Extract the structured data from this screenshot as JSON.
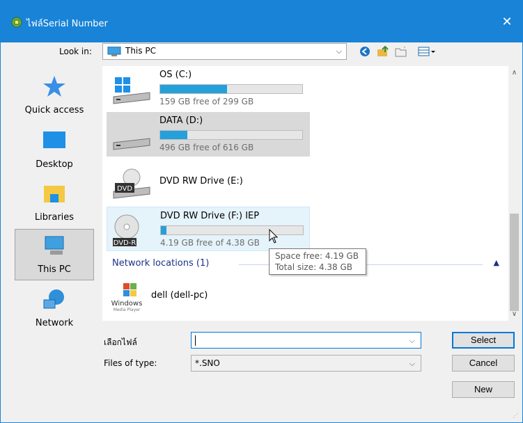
{
  "window": {
    "title": "ไฟล์Serial Number",
    "close_label": "✕"
  },
  "lookin": {
    "label": "Look in:",
    "value": "This PC"
  },
  "places": [
    {
      "label": "Quick access"
    },
    {
      "label": "Desktop"
    },
    {
      "label": "Libraries"
    },
    {
      "label": "This PC"
    },
    {
      "label": "Network"
    }
  ],
  "drives": [
    {
      "name": "OS (C:)",
      "free": "159 GB free of 299 GB",
      "used_fraction": 0.47
    },
    {
      "name": "DATA (D:)",
      "free": "496 GB free of 616 GB",
      "used_fraction": 0.19
    },
    {
      "name": "DVD RW Drive (E:)",
      "badge": "DVD"
    },
    {
      "name": "DVD RW Drive (F:) IEP",
      "free": "4.19 GB free of 4.38 GB",
      "used_fraction": 0.04,
      "badge": "DVD-R"
    }
  ],
  "network_group": {
    "label": "Network locations (1)"
  },
  "network_item": {
    "name": "dell (dell-pc)",
    "icon_text_1": "Windows",
    "icon_text_2": "Media Player"
  },
  "tooltip": {
    "line1": "Space free: 4.19 GB",
    "line2": "Total size: 4.38 GB"
  },
  "file_name": {
    "label": "เลือกไฟล์",
    "value": ""
  },
  "file_type": {
    "label": "Files of type:",
    "value": "*.SNO"
  },
  "buttons": {
    "select": "Select",
    "cancel": "Cancel",
    "new": "New"
  },
  "colors": {
    "titlebar": "#1883d7",
    "accent": "#26a0da"
  }
}
